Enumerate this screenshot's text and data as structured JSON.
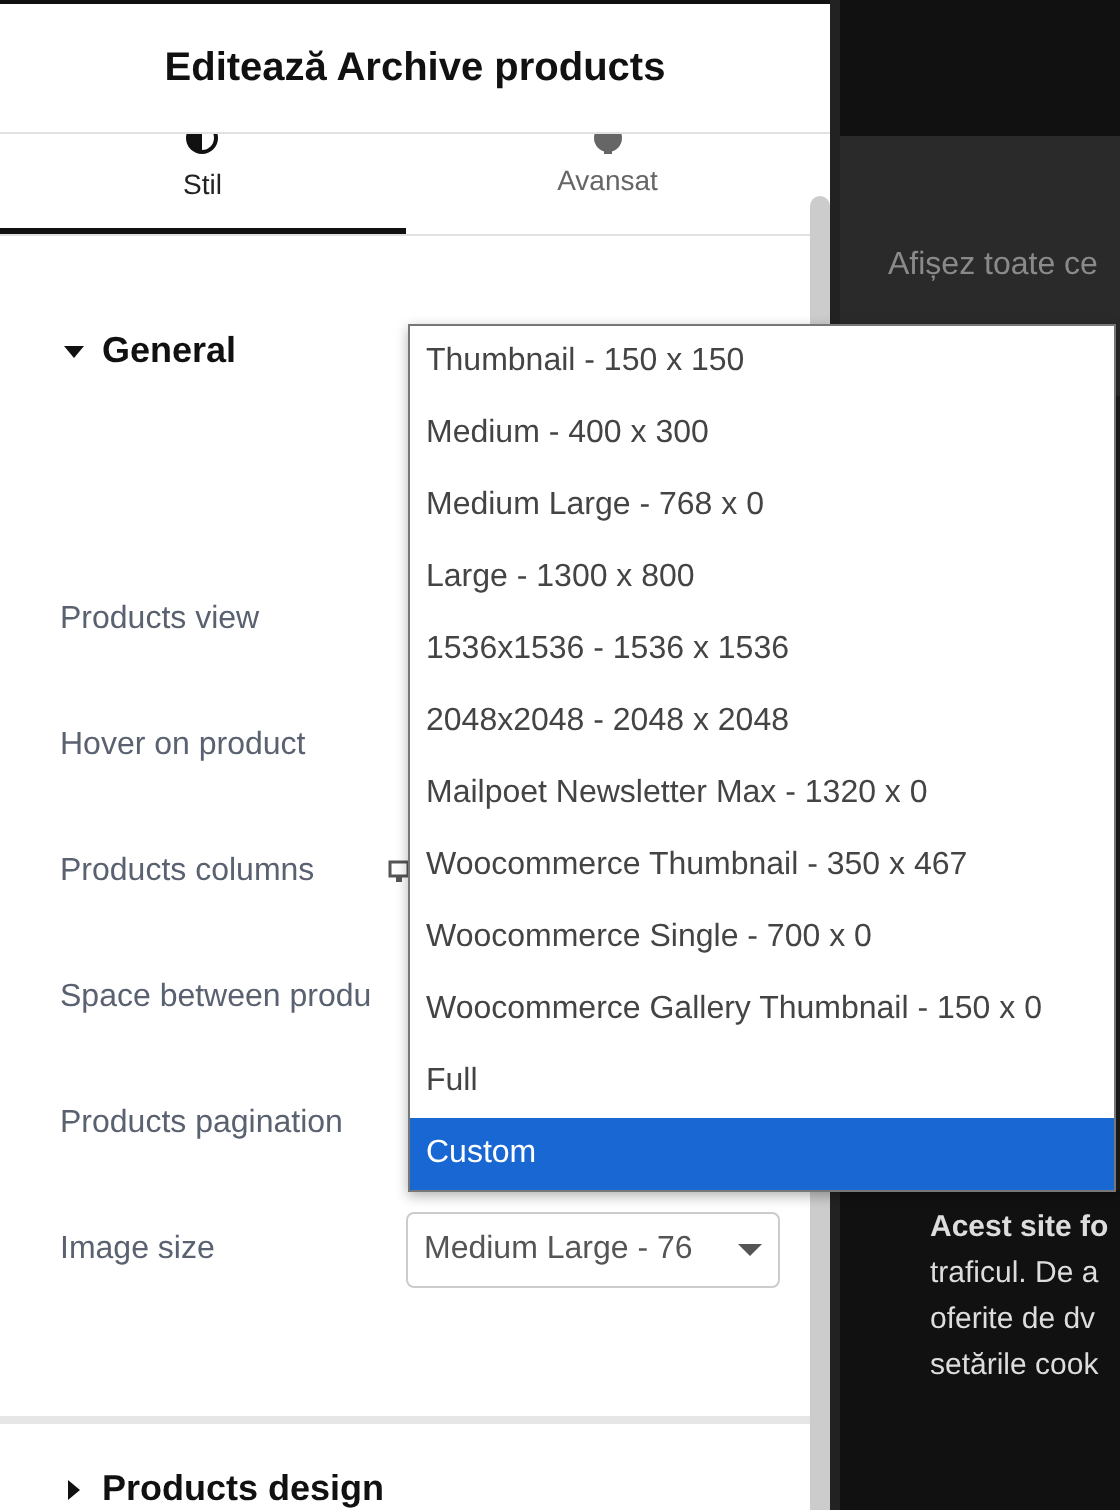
{
  "panel": {
    "title": "Editează Archive products"
  },
  "tabs": [
    {
      "label": "Stil",
      "kind": "contrast",
      "selected": true
    },
    {
      "label": "Avansat",
      "kind": "gear",
      "selected": false
    }
  ],
  "sections": [
    {
      "title": "General",
      "expanded": true
    },
    {
      "title": "Products design",
      "expanded": false
    }
  ],
  "fields": [
    {
      "label": "Products view"
    },
    {
      "label": "Hover on product"
    },
    {
      "label": "Products columns",
      "kind": "responsive"
    },
    {
      "label": "Space between produ"
    },
    {
      "label": "Products pagination"
    },
    {
      "label": "Image size",
      "kind": "select",
      "value": "Medium Large - 76"
    }
  ],
  "dropdown": [
    {
      "label": "Thumbnail - 150 x 150",
      "selected": false
    },
    {
      "label": "Medium - 400 x 300",
      "selected": false
    },
    {
      "label": "Medium Large - 768 x 0",
      "selected": false
    },
    {
      "label": "Large - 1300 x 800",
      "selected": false
    },
    {
      "label": "1536x1536 - 1536 x 1536",
      "selected": false
    },
    {
      "label": "2048x2048 - 2048 x 2048",
      "selected": false
    },
    {
      "label": "Mailpoet Newsletter Max - 1320 x 0",
      "selected": false
    },
    {
      "label": "Woocommerce Thumbnail - 350 x 467",
      "selected": false
    },
    {
      "label": "Woocommerce Single - 700 x 0",
      "selected": false
    },
    {
      "label": "Woocommerce Gallery Thumbnail - 150 x 0",
      "selected": false
    },
    {
      "label": "Full",
      "selected": false
    },
    {
      "label": "Custom",
      "selected": true
    }
  ],
  "preview": {
    "heading": "Afișez toate ce",
    "notice": [
      "**Acest site fo**",
      "traficul. De a",
      "oferite de dv",
      "setările cook"
    ]
  }
}
